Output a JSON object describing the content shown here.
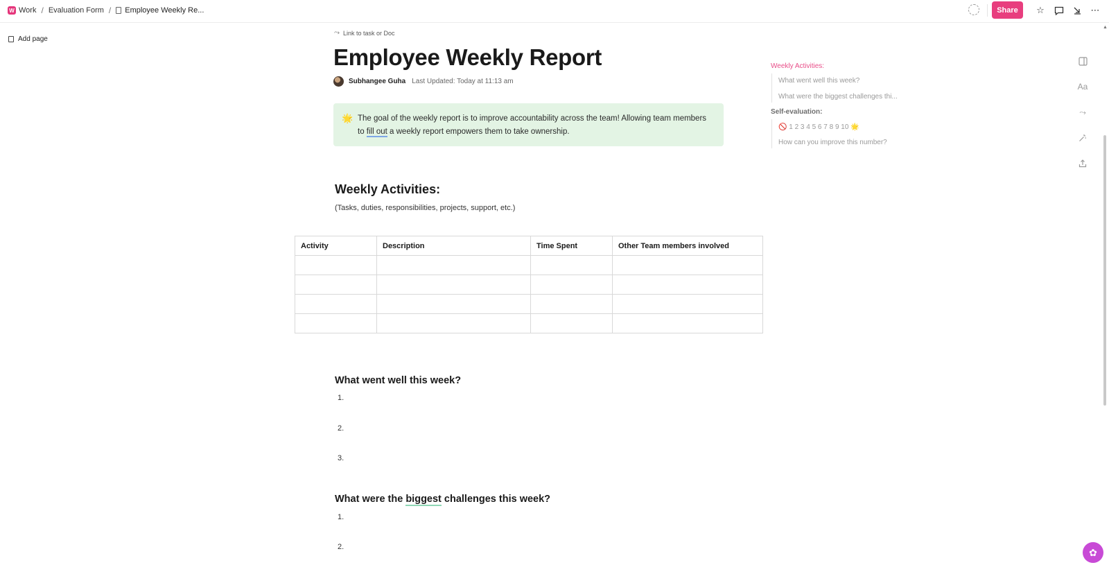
{
  "breadcrumb": {
    "workspace_badge": "W",
    "workspace": "Work",
    "folder": "Evaluation Form",
    "current": "Employee Weekly Re..."
  },
  "toolbar": {
    "share_label": "Share",
    "icons": [
      "ai-icon",
      "star-icon",
      "comment-icon",
      "collapse-icon",
      "more-icon"
    ]
  },
  "sidebar": {
    "add_page": "Add page"
  },
  "doc": {
    "link_task": "Link to task or Doc",
    "title": "Employee Weekly Report",
    "author": "Subhangee Guha",
    "last_updated": "Last Updated: Today at 11:13 am",
    "callout": {
      "emoji": "🌟",
      "text_before": "The goal of the weekly report is to improve accountability across the team! Allowing team members to ",
      "text_underlined": "fill out",
      "text_after": " a weekly report empowers them to take ownership."
    },
    "section1": {
      "heading": "Weekly Activities:",
      "subtitle": "(Tasks, duties, responsibilities, projects, support, etc.)"
    },
    "table": {
      "headers": [
        "Activity",
        "Description",
        "Time Spent",
        "Other Team members involved"
      ],
      "rows": [
        [
          "",
          "",
          "",
          ""
        ],
        [
          "",
          "",
          "",
          ""
        ],
        [
          "",
          "",
          "",
          ""
        ],
        [
          "",
          "",
          "",
          ""
        ]
      ]
    },
    "section2": {
      "heading": "What went well this week?",
      "items": [
        "1.",
        "2.",
        "3."
      ]
    },
    "section3": {
      "heading_before": "What were the ",
      "heading_underlined": "biggest",
      "heading_after": " challenges this week?",
      "items": [
        "1.",
        "2."
      ]
    }
  },
  "toc": {
    "head1": "Weekly Activities:",
    "items1": [
      "What went well this week?",
      "What were the biggest challenges thi..."
    ],
    "head2": "Self-evaluation:",
    "scale_icon": "🚫",
    "scale": "1 2 3 4 5 6 7 8 9 10",
    "scale_end_icon": "🌟",
    "items2_last": "How can you improve this number?"
  },
  "colors": {
    "accent": "#e83e7e",
    "callout_bg": "#e3f4e4",
    "fab": "#c84ad6"
  }
}
